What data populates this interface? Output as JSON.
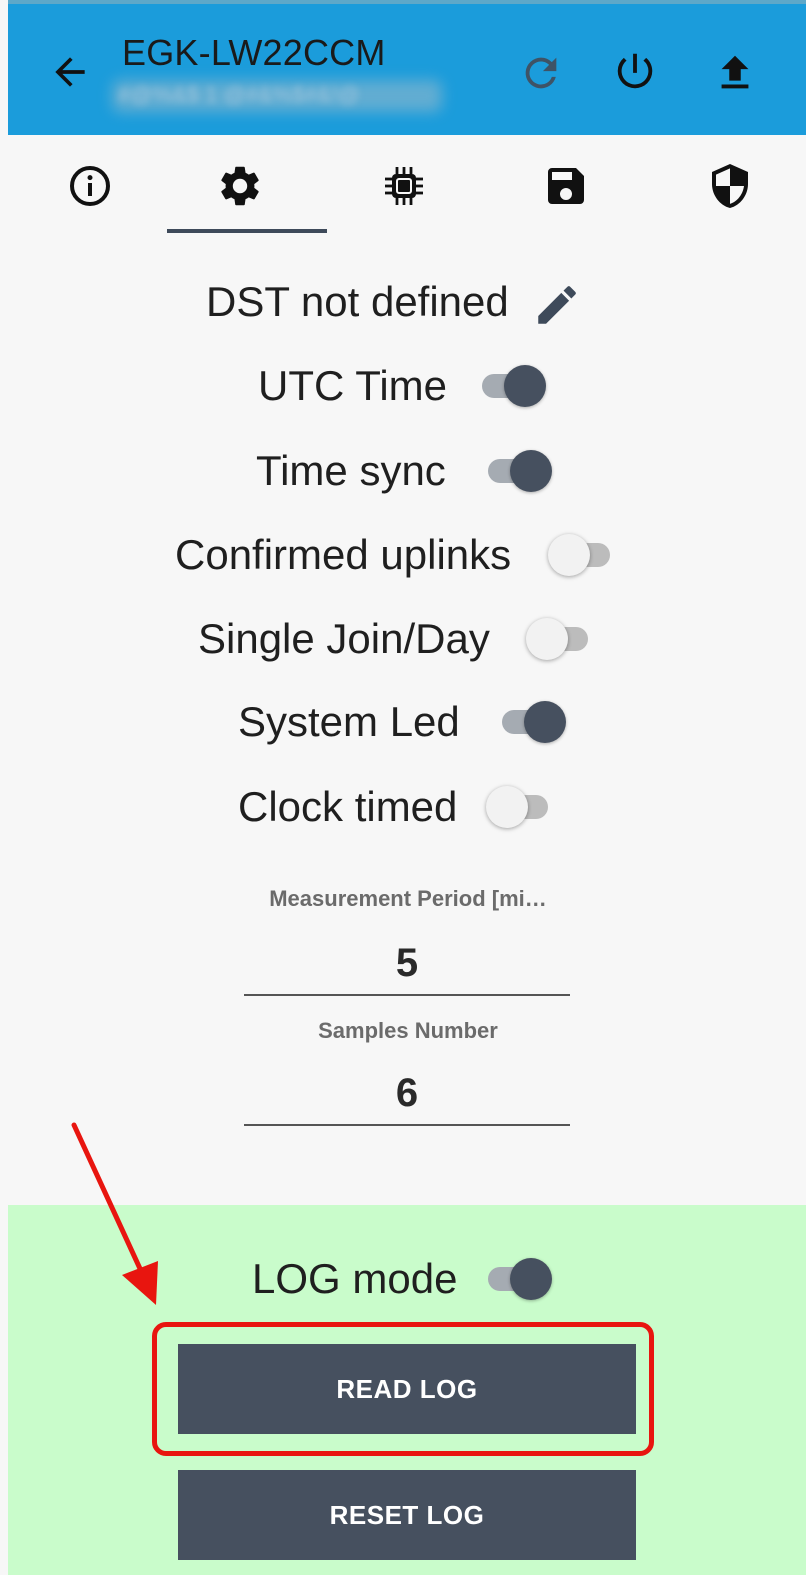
{
  "header": {
    "title": "EGK-LW22CCM",
    "subtitle": "#@%&$ 1 @#&%$#&!@",
    "icons": [
      "arrow-back-icon",
      "refresh-icon",
      "power-icon",
      "upload-icon"
    ]
  },
  "tabs": [
    {
      "icon": "info-icon",
      "selected": false
    },
    {
      "icon": "gear-icon",
      "selected": true
    },
    {
      "icon": "chip-icon",
      "selected": false
    },
    {
      "icon": "save-icon",
      "selected": false
    },
    {
      "icon": "shield-icon",
      "selected": false
    }
  ],
  "settings": {
    "dst": {
      "label": "DST not defined",
      "icon": "pencil-icon"
    },
    "utc_time": {
      "label": "UTC Time",
      "on": true
    },
    "time_sync": {
      "label": "Time sync",
      "on": true
    },
    "confirmed_uplinks": {
      "label": "Confirmed uplinks",
      "on": false
    },
    "single_join": {
      "label": "Single Join/Day",
      "on": false
    },
    "system_led": {
      "label": "System Led",
      "on": true
    },
    "clock_timed": {
      "label": "Clock timed",
      "on": false
    }
  },
  "fields": {
    "measurement_period": {
      "label": "Measurement Period [mi…",
      "value": "5"
    },
    "samples_number": {
      "label": "Samples Number",
      "value": "6"
    }
  },
  "log": {
    "mode": {
      "label": "LOG mode",
      "on": true
    },
    "read_button": "READ LOG",
    "reset_button": "RESET LOG"
  },
  "colors": {
    "header_bg": "#1b9cdb",
    "log_panel_bg": "#c9fccb",
    "button_bg": "#46505f",
    "annotation_red": "#e8150f"
  }
}
